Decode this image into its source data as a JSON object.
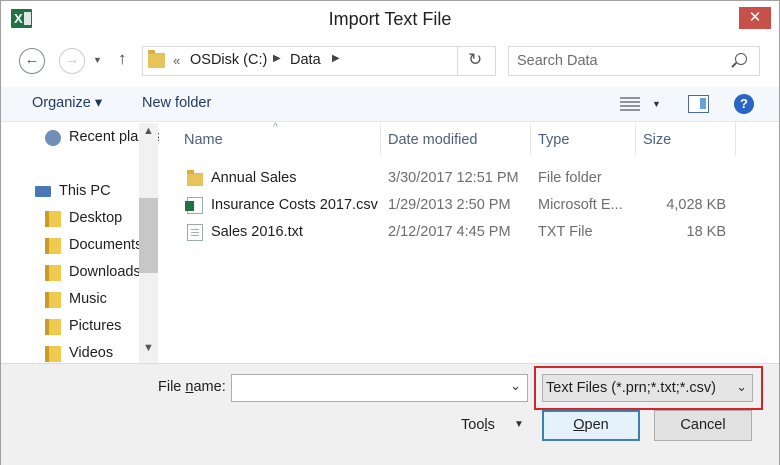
{
  "window": {
    "title": "Import Text File",
    "close_glyph": "✕",
    "app_icon_letter": "X"
  },
  "nav": {
    "back_glyph": "←",
    "forward_glyph": "→",
    "recent_glyph": "▼",
    "up_glyph": "↑",
    "address": {
      "overflow_chevron": "«",
      "crumbs": [
        "OSDisk (C:)",
        "Data"
      ],
      "separator": "▶"
    },
    "refresh_glyph": "↻",
    "search_placeholder": "Search Data"
  },
  "toolbar": {
    "organize_label": "Organize ▾",
    "new_folder_label": "New folder",
    "view_dropdown_glyph": "▼",
    "help_glyph": "?"
  },
  "nav_pane": {
    "items": [
      {
        "label": "Recent places",
        "icon": "recent-places-icon"
      },
      {
        "label": "This PC",
        "icon": "computer-icon"
      },
      {
        "label": "Desktop",
        "icon": "desktop-folder-icon"
      },
      {
        "label": "Documents",
        "icon": "documents-folder-icon"
      },
      {
        "label": "Downloads",
        "icon": "downloads-folder-icon"
      },
      {
        "label": "Music",
        "icon": "music-folder-icon"
      },
      {
        "label": "Pictures",
        "icon": "pictures-folder-icon"
      },
      {
        "label": "Videos",
        "icon": "videos-folder-icon"
      }
    ],
    "scroll_up_glyph": "▲",
    "scroll_down_glyph": "▼"
  },
  "file_list": {
    "columns": [
      "Name",
      "Date modified",
      "Type",
      "Size"
    ],
    "sort_glyph": "^",
    "rows": [
      {
        "name": "Annual Sales",
        "date": "3/30/2017 12:51 PM",
        "type": "File folder",
        "size": "",
        "icon": "folder-icon"
      },
      {
        "name": "Insurance Costs 2017.csv",
        "date": "1/29/2013 2:50 PM",
        "type": "Microsoft E...",
        "size": "4,028 KB",
        "icon": "excel-csv-file-icon"
      },
      {
        "name": "Sales 2016.txt",
        "date": "2/12/2017 4:45 PM",
        "type": "TXT File",
        "size": "18 KB",
        "icon": "text-file-icon"
      }
    ]
  },
  "bottom": {
    "file_name_label_pre": "File ",
    "file_name_label_ul": "n",
    "file_name_label_post": "ame:",
    "file_name_value": "",
    "file_type_selected": "Text Files (*.prn;*.txt;*.csv)",
    "dropdown_glyph": "⌄",
    "tools_label_pre": "Too",
    "tools_label_ul": "l",
    "tools_label_post": "s",
    "tools_dd_glyph": "▼",
    "open_label_ul": "O",
    "open_label_post": "pen",
    "cancel_label": "Cancel",
    "highlight_color": "#d2262a"
  }
}
